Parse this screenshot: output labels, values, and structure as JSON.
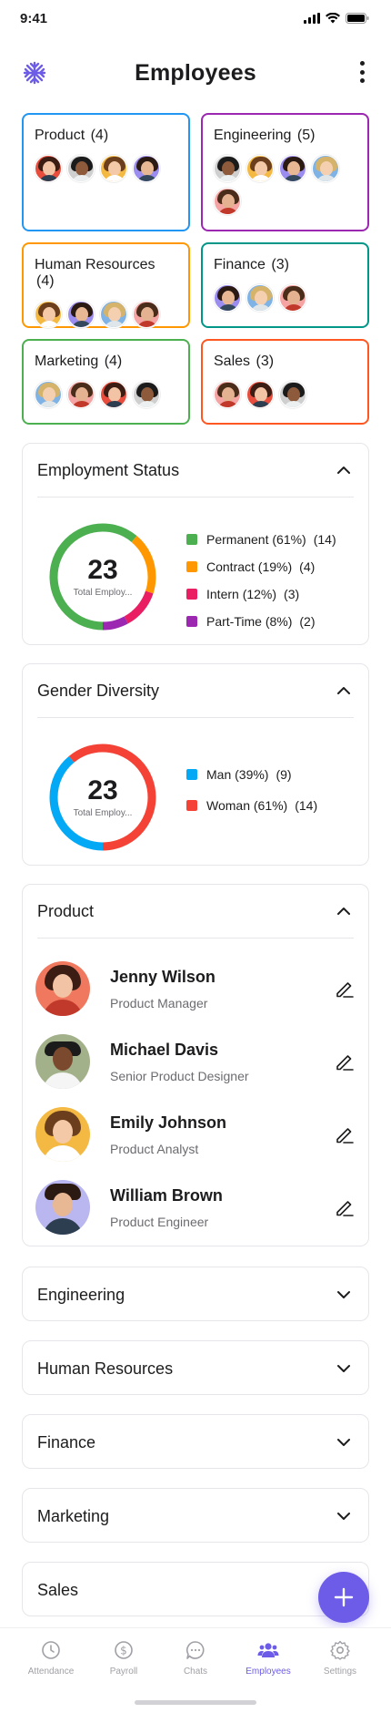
{
  "status_bar": {
    "time": "9:41"
  },
  "header": {
    "title": "Employees",
    "logo_icon": "snowflake-icon",
    "more_icon": "more-vertical-icon"
  },
  "departments": [
    {
      "name": "Product",
      "count": "(4)",
      "color": "#2196f3",
      "avatars": 4
    },
    {
      "name": "Engineering",
      "count": "(5)",
      "color": "#9c27b0",
      "avatars": 5
    },
    {
      "name": "Human Resources",
      "count": "(4)",
      "color": "#ff9800",
      "avatars": 4
    },
    {
      "name": "Finance",
      "count": "(3)",
      "color": "#009688",
      "avatars": 3
    },
    {
      "name": "Marketing",
      "count": "(4)",
      "color": "#4caf50",
      "avatars": 4
    },
    {
      "name": "Sales",
      "count": "(3)",
      "color": "#ff5722",
      "avatars": 3
    }
  ],
  "employment_status": {
    "title": "Employment Status",
    "total": "23",
    "total_label": "Total Employ...",
    "legend": [
      {
        "label": "Permanent (61%)",
        "count": "(14)",
        "color": "#4caf50"
      },
      {
        "label": "Contract (19%)",
        "count": "(4)",
        "color": "#ff9800"
      },
      {
        "label": "Intern (12%)",
        "count": "(3)",
        "color": "#e91e63"
      },
      {
        "label": "Part-Time (8%)",
        "count": "(2)",
        "color": "#9c27b0"
      }
    ]
  },
  "gender_diversity": {
    "title": "Gender Diversity",
    "total": "23",
    "total_label": "Total Employ...",
    "legend": [
      {
        "label": "Man (39%)",
        "count": "(9)",
        "color": "#03a9f4"
      },
      {
        "label": "Woman (61%)",
        "count": "(14)",
        "color": "#f44336"
      }
    ]
  },
  "product_section": {
    "title": "Product",
    "employees": [
      {
        "name": "Jenny Wilson",
        "role": "Product Manager"
      },
      {
        "name": "Michael Davis",
        "role": "Senior Product Designer"
      },
      {
        "name": "Emily Johnson",
        "role": "Product Analyst"
      },
      {
        "name": "William Brown",
        "role": "Product Engineer"
      }
    ]
  },
  "collapsed_sections": [
    "Engineering",
    "Human Resources",
    "Finance",
    "Marketing",
    "Sales"
  ],
  "nav": {
    "items": [
      {
        "label": "Attendance",
        "icon": "clock-icon"
      },
      {
        "label": "Payroll",
        "icon": "dollar-icon"
      },
      {
        "label": "Chats",
        "icon": "chat-icon"
      },
      {
        "label": "Employees",
        "icon": "users-icon",
        "active": true
      },
      {
        "label": "Settings",
        "icon": "gear-icon"
      }
    ]
  },
  "accent_color": "#6c5ce7"
}
